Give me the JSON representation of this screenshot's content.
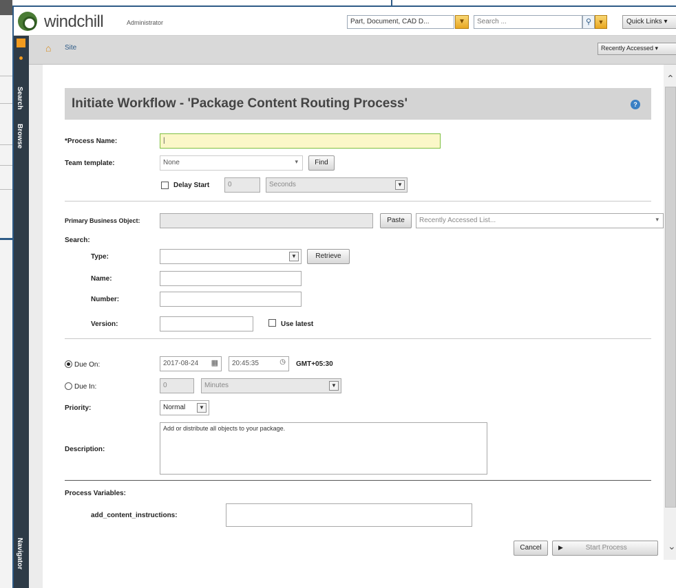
{
  "topbar": {
    "brand": "windchill",
    "role": "Administrator",
    "scope_select": "Part, Document, CAD D...",
    "search_placeholder": "Search ...",
    "quick_links": "Quick Links ▾"
  },
  "rail": {
    "search_tab": "Search",
    "browse_tab": "Browse",
    "navigator_tab": "Navigator"
  },
  "breadcrumb": {
    "site": "Site",
    "recently_accessed": "Recently Accessed ▾"
  },
  "form": {
    "title": "Initiate Workflow - 'Package Content Routing Process'",
    "process_name_label": "*Process Name:",
    "process_name_value": "|",
    "team_template_label": "Team template:",
    "team_template_value": "None",
    "find_button": "Find",
    "delay_start_label": "Delay Start",
    "delay_value": "0",
    "delay_unit": "Seconds",
    "primary_business_object_label": "Primary Business Object:",
    "paste_button": "Paste",
    "recently_accessed_list": "Recently Accessed List...",
    "search_label": "Search:",
    "type_label": "Type:",
    "retrieve_button": "Retrieve",
    "name_label": "Name:",
    "number_label": "Number:",
    "version_label": "Version:",
    "use_latest_label": "Use latest",
    "due_on_label": "Due On:",
    "due_date": "2017-08-24",
    "due_time": "20:45:35",
    "timezone": "GMT+05:30",
    "due_in_label": "Due In:",
    "due_in_value": "0",
    "due_in_unit": "Minutes",
    "priority_label": "Priority:",
    "priority_value": "Normal",
    "description_label": "Description:",
    "description_value": "Add or distribute all objects to your package.",
    "process_variables_label": "Process Variables:",
    "add_content_instructions_label": "add_content_instructions:",
    "add_content_instructions_value": "",
    "cancel_button": "Cancel",
    "start_process_button": "Start Process"
  }
}
